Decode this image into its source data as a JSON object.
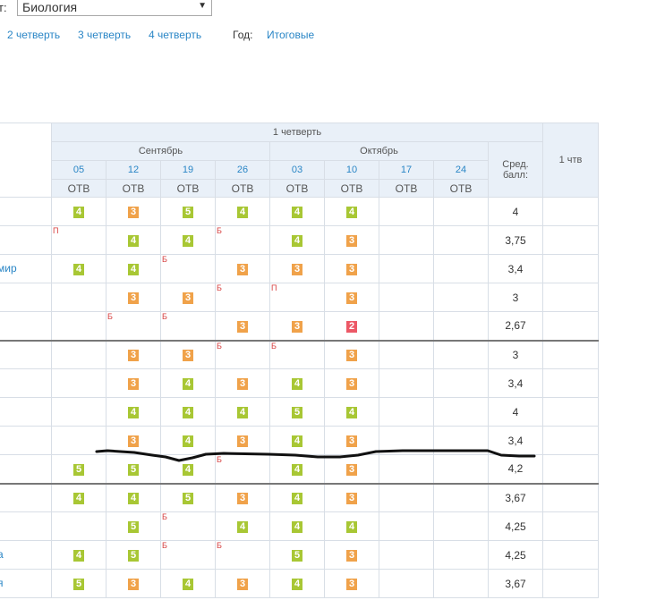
{
  "subject": {
    "label": "т:",
    "value": "Биология"
  },
  "quarter_nav": [
    "2 четверть",
    "3 четверть",
    "4 четверть"
  ],
  "year_label": "Год:",
  "final_link": "Итоговые",
  "table": {
    "quarter_title": "1 четверть",
    "months": [
      "Сентябрь",
      "Октябрь"
    ],
    "dates": [
      "05",
      "12",
      "19",
      "26",
      "03",
      "10",
      "17",
      "24"
    ],
    "work_type": "ОТВ",
    "avg_header": "Сред. балл:",
    "quarter_mark_header": "1 чтв",
    "rows": [
      {
        "name": "",
        "grades": [
          "4",
          "3",
          "5",
          "4",
          "4",
          "4",
          "",
          ""
        ],
        "marks": [
          "",
          "",
          "",
          "",
          "",
          "",
          "",
          ""
        ],
        "avg": "4"
      },
      {
        "name": "",
        "grades": [
          "",
          "4",
          "4",
          "",
          "4",
          "3",
          "",
          ""
        ],
        "marks": [
          "П",
          "",
          "",
          "Б",
          "",
          "",
          "",
          ""
        ],
        "avg": "3,75"
      },
      {
        "name": "мир",
        "grades": [
          "4",
          "4",
          "",
          "3",
          "3",
          "3",
          "",
          ""
        ],
        "marks": [
          "",
          "",
          "Б",
          "",
          "",
          "",
          "",
          ""
        ],
        "avg": "3,4"
      },
      {
        "name": "",
        "grades": [
          "",
          "3",
          "3",
          "",
          "",
          "3",
          "",
          ""
        ],
        "marks": [
          "",
          "",
          "",
          "Б",
          "П",
          "",
          "",
          ""
        ],
        "avg": "3"
      },
      {
        "name": "",
        "grades": [
          "",
          "",
          "",
          "3",
          "3",
          "2",
          "",
          ""
        ],
        "marks": [
          "",
          "Б",
          "Б",
          "",
          "",
          "",
          "",
          ""
        ],
        "avg": "2,67"
      },
      {
        "name": "",
        "grades": [
          "",
          "3",
          "3",
          "",
          "",
          "3",
          "",
          ""
        ],
        "marks": [
          "",
          "",
          "",
          "Б",
          "Б",
          "",
          "",
          ""
        ],
        "avg": "3"
      },
      {
        "name": "",
        "grades": [
          "",
          "3",
          "4",
          "3",
          "4",
          "3",
          "",
          ""
        ],
        "marks": [
          "",
          "",
          "",
          "",
          "",
          "",
          "",
          ""
        ],
        "avg": "3,4"
      },
      {
        "name": "",
        "grades": [
          "",
          "4",
          "4",
          "4",
          "5",
          "4",
          "",
          ""
        ],
        "marks": [
          "",
          "",
          "",
          "",
          "",
          "",
          "",
          ""
        ],
        "avg": "4"
      },
      {
        "name": "",
        "grades": [
          "",
          "3",
          "4",
          "3",
          "4",
          "3",
          "",
          ""
        ],
        "marks": [
          "",
          "",
          "",
          "",
          "",
          "",
          "",
          ""
        ],
        "avg": "3,4"
      },
      {
        "name": "",
        "grades": [
          "5",
          "5",
          "4",
          "",
          "4",
          "3",
          "",
          ""
        ],
        "marks": [
          "",
          "",
          "",
          "Б",
          "",
          "",
          "",
          ""
        ],
        "avg": "4,2"
      },
      {
        "name": "",
        "grades": [
          "4",
          "4",
          "5",
          "3",
          "4",
          "3",
          "",
          ""
        ],
        "marks": [
          "",
          "",
          "",
          "",
          "",
          "",
          "",
          ""
        ],
        "avg": "3,67"
      },
      {
        "name": "",
        "grades": [
          "",
          "5",
          "",
          "4",
          "4",
          "4",
          "",
          ""
        ],
        "marks": [
          "",
          "",
          "Б",
          "",
          "",
          "",
          "",
          ""
        ],
        "avg": "4,25"
      },
      {
        "name": "а",
        "grades": [
          "4",
          "5",
          "",
          "",
          "5",
          "3",
          "",
          ""
        ],
        "marks": [
          "",
          "",
          "Б",
          "Б",
          "",
          "",
          "",
          ""
        ],
        "avg": "4,25"
      },
      {
        "name": "я",
        "grades": [
          "5",
          "3",
          "4",
          "3",
          "4",
          "3",
          "",
          ""
        ],
        "marks": [
          "",
          "",
          "",
          "",
          "",
          "",
          "",
          ""
        ],
        "avg": "3,67"
      }
    ]
  },
  "colors": {
    "link": "#2a86c6",
    "grade_high": "#a8c734",
    "grade_mid": "#f0a24a",
    "grade_low": "#ec5866",
    "header_bg": "#e9f0f8"
  }
}
